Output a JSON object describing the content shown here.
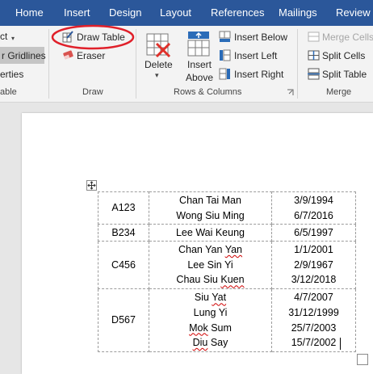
{
  "tabs": [
    "Home",
    "Insert",
    "Design",
    "Layout",
    "References",
    "Mailings",
    "Review"
  ],
  "ribbon": {
    "partial_left": [
      "ct",
      "r Gridlines",
      "erties",
      "able"
    ],
    "draw": {
      "draw_table": "Draw Table",
      "eraser": "Eraser",
      "label": "Draw"
    },
    "rows_columns": {
      "delete": "Delete",
      "insert_above_line1": "Insert",
      "insert_above_line2": "Above",
      "insert_below": "Insert Below",
      "insert_left": "Insert Left",
      "insert_right": "Insert Right",
      "label": "Rows & Columns"
    },
    "merge": {
      "merge_cells": "Merge Cells",
      "split_cells": "Split Cells",
      "split_table": "Split Table",
      "label": "Merge"
    }
  },
  "table": {
    "rows": [
      {
        "code": "A123",
        "names": [
          "Chan Tai Man",
          "Wong Siu Ming"
        ],
        "dates": [
          "3/9/1994",
          "6/7/2016"
        ]
      },
      {
        "code": "B234",
        "names": [
          "Lee Wai Keung"
        ],
        "dates": [
          "6/5/1997"
        ]
      },
      {
        "code": "C456",
        "names": [
          "Chan Yan Yan",
          "Lee Sin Yi",
          "Chau Siu Kuen"
        ],
        "dates": [
          "1/1/2001",
          "2/9/1967",
          "3/12/2018"
        ]
      },
      {
        "code": "D567",
        "names": [
          "Siu Yat",
          "Lung Yi",
          "Mok Sum",
          "Diu Say"
        ],
        "dates": [
          "4/7/2007",
          "31/12/1999",
          "25/7/2003",
          "15/7/2002"
        ]
      }
    ]
  },
  "colors": {
    "tab_bar": "#2b579a",
    "highlight_circle": "#e0202a",
    "spell_error": "#d00000"
  }
}
